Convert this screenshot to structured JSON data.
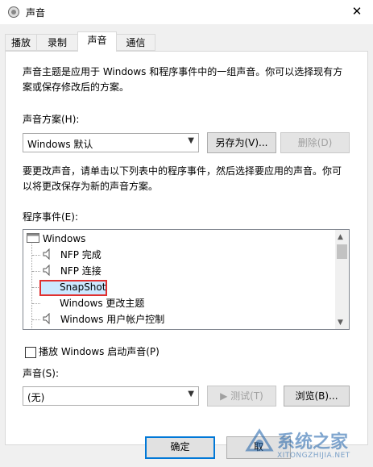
{
  "window": {
    "title": "声音",
    "close_glyph": "✕"
  },
  "tabs": [
    {
      "label": "播放",
      "active": false
    },
    {
      "label": "录制",
      "active": false
    },
    {
      "label": "声音",
      "active": true
    },
    {
      "label": "通信",
      "active": false
    }
  ],
  "intro_text_line1": "声音主题是应用于 Windows 和程序事件中的一组声音。你可以选择现有方",
  "intro_text_line2": "案或保存修改后的方案。",
  "scheme": {
    "label": "声音方案(H):",
    "value": "Windows 默认",
    "save_as_label": "另存为(V)...",
    "delete_label": "删除(D)"
  },
  "change_text_line1": "要更改声音，请单击以下列表中的程序事件，然后选择要应用的声音。你可",
  "change_text_line2": "以将更改保存为新的声音方案。",
  "events": {
    "label": "程序事件(E):",
    "root": "Windows",
    "items": [
      {
        "label": "NFP 完成",
        "has_sound": true,
        "selected": false
      },
      {
        "label": "NFP 连接",
        "has_sound": true,
        "selected": false
      },
      {
        "label": "SnapShot",
        "has_sound": false,
        "selected": true
      },
      {
        "label": "Windows 更改主题",
        "has_sound": false,
        "selected": false
      },
      {
        "label": "Windows 用户帐户控制",
        "has_sound": true,
        "selected": false
      }
    ]
  },
  "startup": {
    "label": "播放 Windows 启动声音(P)",
    "checked": false
  },
  "sound": {
    "label": "声音(S):",
    "value": "(无)",
    "test_label": "▶ 测试(T)",
    "browse_label": "浏览(B)..."
  },
  "footer": {
    "ok_label": "确定",
    "cancel_label": "取"
  },
  "watermark": {
    "text": "系统之家",
    "url": "XITONGZHIJIA.NET"
  },
  "colors": {
    "accent": "#0078d7",
    "selection": "#cce8ff",
    "highlight_box": "#e03030"
  }
}
